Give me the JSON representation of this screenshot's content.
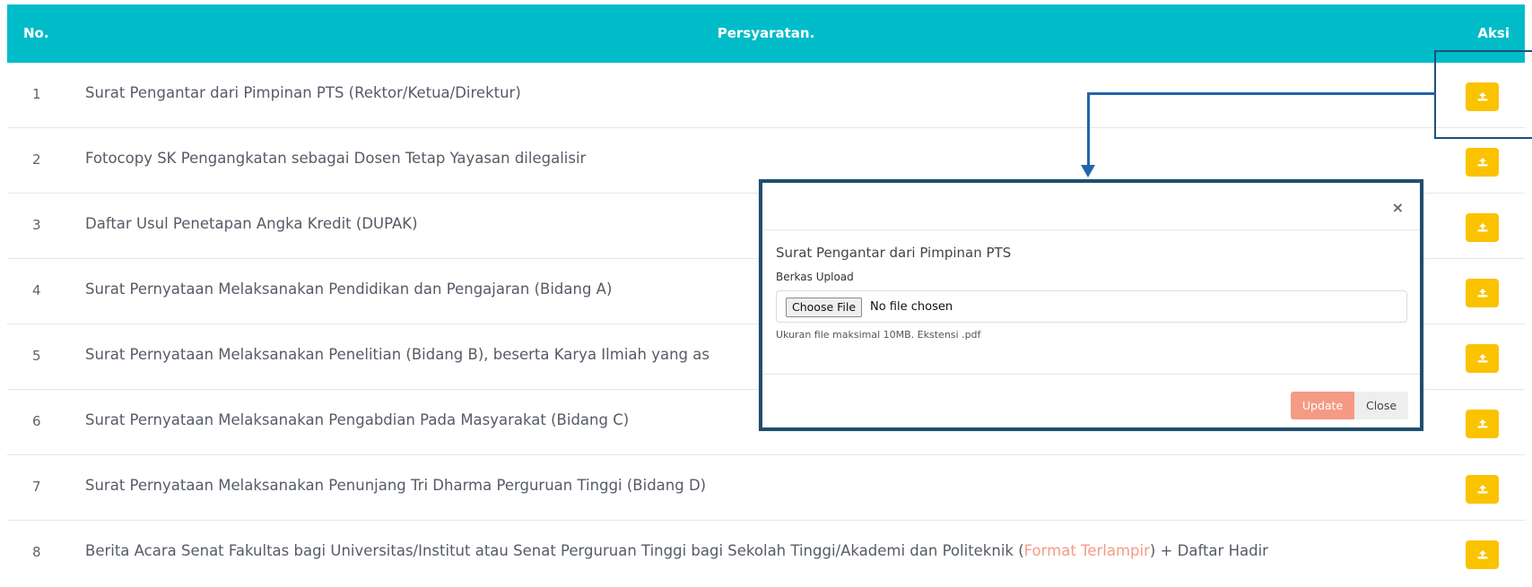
{
  "table": {
    "headers": {
      "no": "No.",
      "requirement": "Persyaratan.",
      "action": "Aksi"
    },
    "rows": [
      {
        "no": "1",
        "text": "Surat Pengantar dari Pimpinan PTS (Rektor/Ketua/Direktur)"
      },
      {
        "no": "2",
        "text": "Fotocopy SK Pengangkatan sebagai Dosen Tetap Yayasan dilegalisir"
      },
      {
        "no": "3",
        "text": "Daftar Usul Penetapan Angka Kredit (DUPAK)"
      },
      {
        "no": "4",
        "text": "Surat Pernyataan Melaksanakan Pendidikan dan Pengajaran (Bidang A)"
      },
      {
        "no": "5",
        "text": "Surat Pernyataan Melaksanakan Penelitian (Bidang B), beserta Karya Ilmiah yang as"
      },
      {
        "no": "6",
        "text": "Surat Pernyataan Melaksanakan Pengabdian Pada Masyarakat (Bidang C)"
      },
      {
        "no": "7",
        "text": "Surat Pernyataan Melaksanakan Penunjang Tri Dharma Perguruan Tinggi (Bidang D)"
      },
      {
        "no": "8",
        "text_before": "Berita Acara Senat Fakultas bagi Universitas/Institut atau Senat Perguruan Tinggi bagi Sekolah Tinggi/Akademi dan Politeknik (",
        "link": "Format Terlampir",
        "text_after": ") + Daftar Hadir"
      }
    ],
    "action_icon": "upload-icon"
  },
  "modal": {
    "close_symbol": "×",
    "title": "Surat Pengantar dari Pimpinan PTS",
    "field_label": "Berkas Upload",
    "choose_file_label": "Choose File",
    "no_file_text": "No file chosen",
    "help_text": "Ukuran file maksimal 10MB. Ekstensi .pdf",
    "update_label": "Update",
    "close_label": "Close"
  },
  "colors": {
    "header_bg": "#00bcc8",
    "upload_button": "#fbc200",
    "update_button": "#f59a84",
    "link": "#f59a84",
    "annotation": "#1f4e79"
  }
}
